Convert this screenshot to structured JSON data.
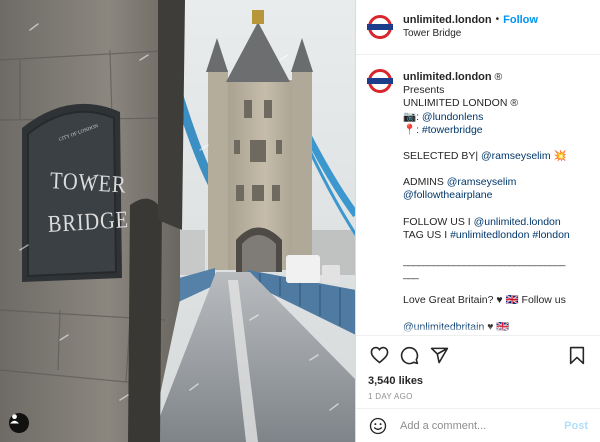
{
  "header": {
    "username": "unlimited.london",
    "separator": "•",
    "follow_label": "Follow",
    "location": "Tower Bridge"
  },
  "photo": {
    "sign_lines": [
      "TOWER",
      "BRIDGE"
    ],
    "sign_small": "CITY OF LONDON",
    "tag_icon": "user-tag-icon"
  },
  "caption": {
    "username": "unlimited.london",
    "verified_mark": "®",
    "lines": {
      "presents": "Presents",
      "brand": "UNLIMITED LONDON ®",
      "camera_emoji": "📷: ",
      "camera_link": "@lundonlens",
      "pin_emoji": "📍: ",
      "pin_link": "#towerbridge",
      "selected_prefix": "SELECTED BY| ",
      "selected_link": "@ramseyselim",
      "selected_emoji": " 💥",
      "admins_prefix": "ADMINS ",
      "admins_link1": "@ramseyselim",
      "admins_link2": "@followtheairplane",
      "follow_prefix": "FOLLOW US I ",
      "follow_link": "@unlimited.london",
      "tag_prefix": "TAG US I ",
      "tag_link1": "#unlimitedlondon",
      "tag_link2": "#london",
      "rule": "________________________________",
      "rule_end": "___",
      "love": "Love Great Britain? ♥ 🇬🇧 Follow us",
      "cutoff_link": "@unlimitedbritain",
      "cutoff_rest": " ♥ 🇬🇧"
    }
  },
  "actions": {
    "icons": [
      "heart-icon",
      "comment-icon",
      "share-icon",
      "bookmark-icon"
    ],
    "likes": "3,540 likes",
    "date": "1 DAY AGO"
  },
  "comment": {
    "placeholder": "Add a comment...",
    "post_label": "Post"
  },
  "colors": {
    "accent": "#0095f6",
    "link": "#00376b",
    "post_disabled": "#b2dffc",
    "muted": "#8e8e8e",
    "roundel_red": "#d8262b",
    "roundel_blue": "#1c3c8c"
  }
}
